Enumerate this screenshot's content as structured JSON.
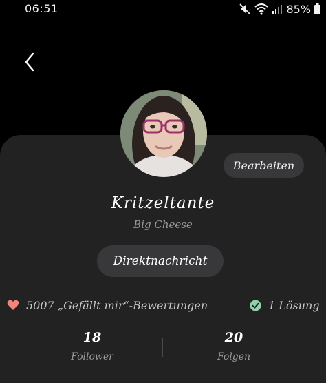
{
  "status_bar": {
    "time": "06:51",
    "battery": "85%"
  },
  "profile": {
    "username": "Kritzeltante",
    "rank": "Big Cheese",
    "edit_label": "Bearbeiten",
    "message_label": "Direktnachricht",
    "likes_text": "5007 „Gefällt mir“-Bewertungen",
    "solutions_text": "1 Lösung",
    "followers_count": "18",
    "followers_label": "Follower",
    "following_count": "20",
    "following_label": "Folgen"
  },
  "colors": {
    "background": "#000000",
    "card": "#222223",
    "button": "#38383a",
    "heart": "#f0857c",
    "check": "#8fd3a8",
    "muted_text": "#9a9a9c"
  }
}
